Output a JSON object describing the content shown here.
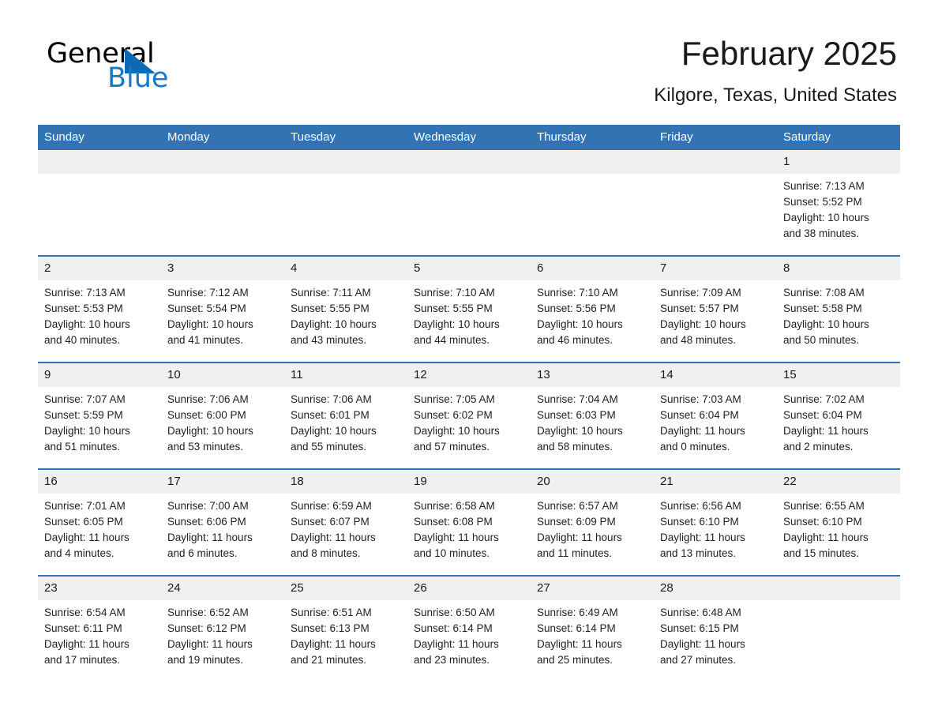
{
  "logo": {
    "word_one": "General",
    "word_two": "Blue",
    "triangle_icon": "triangle-icon",
    "brand_blue": "#1878c4",
    "brand_dark_blue": "#0a6ab4"
  },
  "header": {
    "month_title": "February 2025",
    "location": "Kilgore, Texas, United States",
    "header_bg": "#3273b3",
    "daynum_bg": "#f0f0f0"
  },
  "calendar": {
    "weekday_headers": [
      "Sunday",
      "Monday",
      "Tuesday",
      "Wednesday",
      "Thursday",
      "Friday",
      "Saturday"
    ],
    "weeks": [
      [
        {
          "day": "",
          "sunrise": "",
          "sunset": "",
          "daylight_line1": "",
          "daylight_line2": ""
        },
        {
          "day": "",
          "sunrise": "",
          "sunset": "",
          "daylight_line1": "",
          "daylight_line2": ""
        },
        {
          "day": "",
          "sunrise": "",
          "sunset": "",
          "daylight_line1": "",
          "daylight_line2": ""
        },
        {
          "day": "",
          "sunrise": "",
          "sunset": "",
          "daylight_line1": "",
          "daylight_line2": ""
        },
        {
          "day": "",
          "sunrise": "",
          "sunset": "",
          "daylight_line1": "",
          "daylight_line2": ""
        },
        {
          "day": "",
          "sunrise": "",
          "sunset": "",
          "daylight_line1": "",
          "daylight_line2": ""
        },
        {
          "day": "1",
          "sunrise": "Sunrise: 7:13 AM",
          "sunset": "Sunset: 5:52 PM",
          "daylight_line1": "Daylight: 10 hours",
          "daylight_line2": "and 38 minutes."
        }
      ],
      [
        {
          "day": "2",
          "sunrise": "Sunrise: 7:13 AM",
          "sunset": "Sunset: 5:53 PM",
          "daylight_line1": "Daylight: 10 hours",
          "daylight_line2": "and 40 minutes."
        },
        {
          "day": "3",
          "sunrise": "Sunrise: 7:12 AM",
          "sunset": "Sunset: 5:54 PM",
          "daylight_line1": "Daylight: 10 hours",
          "daylight_line2": "and 41 minutes."
        },
        {
          "day": "4",
          "sunrise": "Sunrise: 7:11 AM",
          "sunset": "Sunset: 5:55 PM",
          "daylight_line1": "Daylight: 10 hours",
          "daylight_line2": "and 43 minutes."
        },
        {
          "day": "5",
          "sunrise": "Sunrise: 7:10 AM",
          "sunset": "Sunset: 5:55 PM",
          "daylight_line1": "Daylight: 10 hours",
          "daylight_line2": "and 44 minutes."
        },
        {
          "day": "6",
          "sunrise": "Sunrise: 7:10 AM",
          "sunset": "Sunset: 5:56 PM",
          "daylight_line1": "Daylight: 10 hours",
          "daylight_line2": "and 46 minutes."
        },
        {
          "day": "7",
          "sunrise": "Sunrise: 7:09 AM",
          "sunset": "Sunset: 5:57 PM",
          "daylight_line1": "Daylight: 10 hours",
          "daylight_line2": "and 48 minutes."
        },
        {
          "day": "8",
          "sunrise": "Sunrise: 7:08 AM",
          "sunset": "Sunset: 5:58 PM",
          "daylight_line1": "Daylight: 10 hours",
          "daylight_line2": "and 50 minutes."
        }
      ],
      [
        {
          "day": "9",
          "sunrise": "Sunrise: 7:07 AM",
          "sunset": "Sunset: 5:59 PM",
          "daylight_line1": "Daylight: 10 hours",
          "daylight_line2": "and 51 minutes."
        },
        {
          "day": "10",
          "sunrise": "Sunrise: 7:06 AM",
          "sunset": "Sunset: 6:00 PM",
          "daylight_line1": "Daylight: 10 hours",
          "daylight_line2": "and 53 minutes."
        },
        {
          "day": "11",
          "sunrise": "Sunrise: 7:06 AM",
          "sunset": "Sunset: 6:01 PM",
          "daylight_line1": "Daylight: 10 hours",
          "daylight_line2": "and 55 minutes."
        },
        {
          "day": "12",
          "sunrise": "Sunrise: 7:05 AM",
          "sunset": "Sunset: 6:02 PM",
          "daylight_line1": "Daylight: 10 hours",
          "daylight_line2": "and 57 minutes."
        },
        {
          "day": "13",
          "sunrise": "Sunrise: 7:04 AM",
          "sunset": "Sunset: 6:03 PM",
          "daylight_line1": "Daylight: 10 hours",
          "daylight_line2": "and 58 minutes."
        },
        {
          "day": "14",
          "sunrise": "Sunrise: 7:03 AM",
          "sunset": "Sunset: 6:04 PM",
          "daylight_line1": "Daylight: 11 hours",
          "daylight_line2": "and 0 minutes."
        },
        {
          "day": "15",
          "sunrise": "Sunrise: 7:02 AM",
          "sunset": "Sunset: 6:04 PM",
          "daylight_line1": "Daylight: 11 hours",
          "daylight_line2": "and 2 minutes."
        }
      ],
      [
        {
          "day": "16",
          "sunrise": "Sunrise: 7:01 AM",
          "sunset": "Sunset: 6:05 PM",
          "daylight_line1": "Daylight: 11 hours",
          "daylight_line2": "and 4 minutes."
        },
        {
          "day": "17",
          "sunrise": "Sunrise: 7:00 AM",
          "sunset": "Sunset: 6:06 PM",
          "daylight_line1": "Daylight: 11 hours",
          "daylight_line2": "and 6 minutes."
        },
        {
          "day": "18",
          "sunrise": "Sunrise: 6:59 AM",
          "sunset": "Sunset: 6:07 PM",
          "daylight_line1": "Daylight: 11 hours",
          "daylight_line2": "and 8 minutes."
        },
        {
          "day": "19",
          "sunrise": "Sunrise: 6:58 AM",
          "sunset": "Sunset: 6:08 PM",
          "daylight_line1": "Daylight: 11 hours",
          "daylight_line2": "and 10 minutes."
        },
        {
          "day": "20",
          "sunrise": "Sunrise: 6:57 AM",
          "sunset": "Sunset: 6:09 PM",
          "daylight_line1": "Daylight: 11 hours",
          "daylight_line2": "and 11 minutes."
        },
        {
          "day": "21",
          "sunrise": "Sunrise: 6:56 AM",
          "sunset": "Sunset: 6:10 PM",
          "daylight_line1": "Daylight: 11 hours",
          "daylight_line2": "and 13 minutes."
        },
        {
          "day": "22",
          "sunrise": "Sunrise: 6:55 AM",
          "sunset": "Sunset: 6:10 PM",
          "daylight_line1": "Daylight: 11 hours",
          "daylight_line2": "and 15 minutes."
        }
      ],
      [
        {
          "day": "23",
          "sunrise": "Sunrise: 6:54 AM",
          "sunset": "Sunset: 6:11 PM",
          "daylight_line1": "Daylight: 11 hours",
          "daylight_line2": "and 17 minutes."
        },
        {
          "day": "24",
          "sunrise": "Sunrise: 6:52 AM",
          "sunset": "Sunset: 6:12 PM",
          "daylight_line1": "Daylight: 11 hours",
          "daylight_line2": "and 19 minutes."
        },
        {
          "day": "25",
          "sunrise": "Sunrise: 6:51 AM",
          "sunset": "Sunset: 6:13 PM",
          "daylight_line1": "Daylight: 11 hours",
          "daylight_line2": "and 21 minutes."
        },
        {
          "day": "26",
          "sunrise": "Sunrise: 6:50 AM",
          "sunset": "Sunset: 6:14 PM",
          "daylight_line1": "Daylight: 11 hours",
          "daylight_line2": "and 23 minutes."
        },
        {
          "day": "27",
          "sunrise": "Sunrise: 6:49 AM",
          "sunset": "Sunset: 6:14 PM",
          "daylight_line1": "Daylight: 11 hours",
          "daylight_line2": "and 25 minutes."
        },
        {
          "day": "28",
          "sunrise": "Sunrise: 6:48 AM",
          "sunset": "Sunset: 6:15 PM",
          "daylight_line1": "Daylight: 11 hours",
          "daylight_line2": "and 27 minutes."
        },
        {
          "day": "",
          "sunrise": "",
          "sunset": "",
          "daylight_line1": "",
          "daylight_line2": ""
        }
      ]
    ]
  }
}
